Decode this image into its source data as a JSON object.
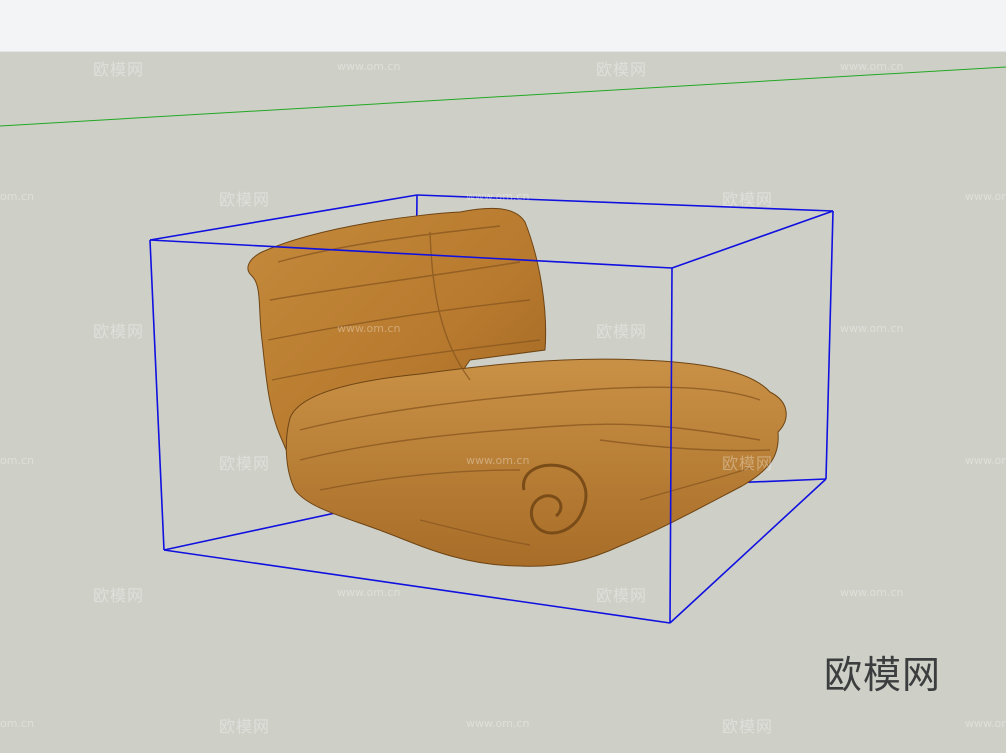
{
  "toolbar": {},
  "viewport": {
    "background": "#ced0c8",
    "green_axis_color": "#22a822",
    "bounding_box_color": "#1010e0",
    "model_color": "#b97a30"
  },
  "watermarks": {
    "text_cn": "欧模网",
    "text_url": "www.om.cn",
    "text_url_partial": "om.cn"
  },
  "brand": {
    "label": "欧模网"
  }
}
